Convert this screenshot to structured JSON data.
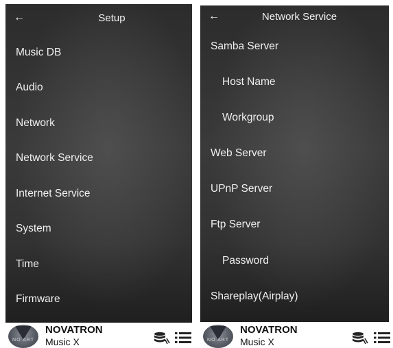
{
  "left": {
    "back_icon": "←",
    "title": "Setup",
    "items": [
      {
        "label": "Music DB"
      },
      {
        "label": "Audio"
      },
      {
        "label": "Network"
      },
      {
        "label": "Network Service"
      },
      {
        "label": "Internet Service"
      },
      {
        "label": "System"
      },
      {
        "label": "Time"
      },
      {
        "label": "Firmware"
      }
    ]
  },
  "right": {
    "back_icon": "←",
    "title": "Network Service",
    "items": [
      {
        "label": "Samba Server"
      },
      {
        "label": "Host Name"
      },
      {
        "label": "Workgroup"
      },
      {
        "label": "Web Server"
      },
      {
        "label": "UPnP Server"
      },
      {
        "label": "Ftp Server"
      },
      {
        "label": "Password"
      },
      {
        "label": "Shareplay(Airplay)"
      }
    ]
  },
  "footer": {
    "brand": "NOVATRON",
    "sub": "Music X",
    "logo_text": "NO  ART",
    "icons": [
      "database-icon",
      "list-menu-icon"
    ]
  },
  "colors": {
    "background": "#2f2f2f",
    "text": "#f0f0f0",
    "footer_bg": "#ffffff",
    "footer_text": "#111111"
  }
}
